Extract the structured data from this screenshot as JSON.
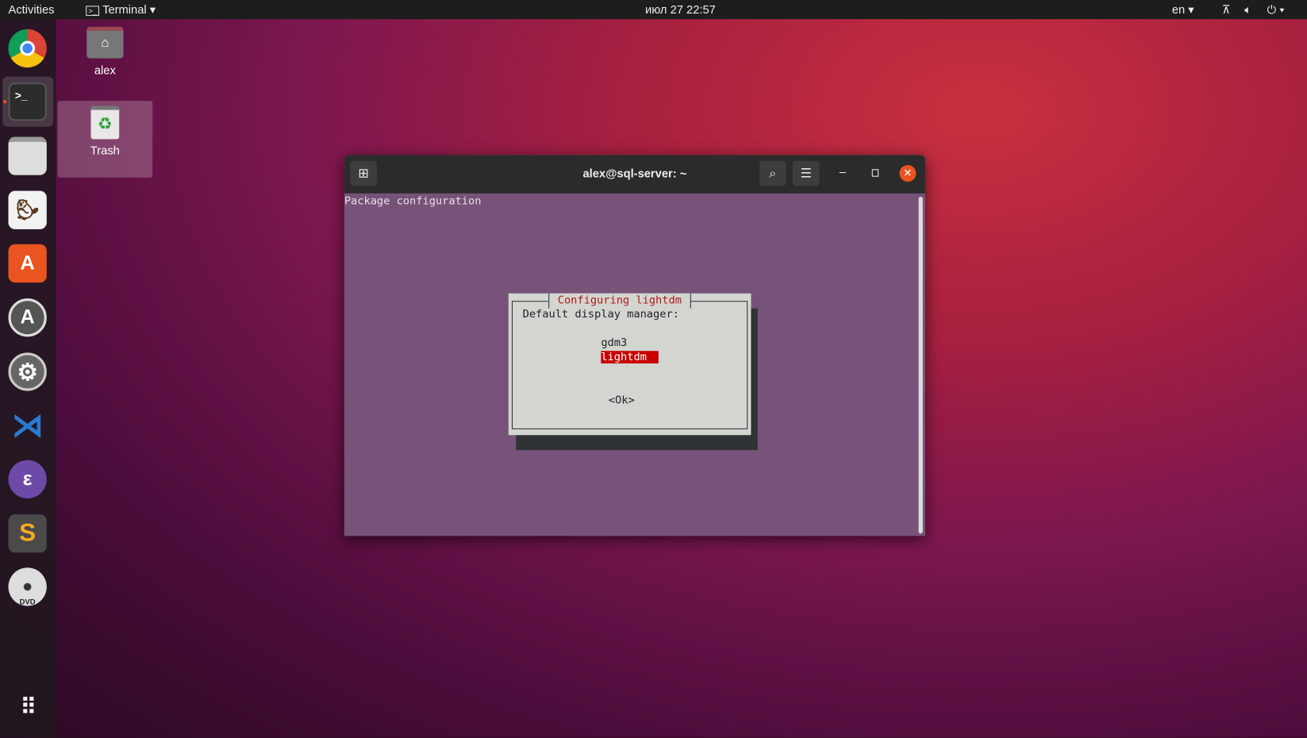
{
  "topbar": {
    "activities": "Activities",
    "app_menu": "Terminal",
    "clock": "июл 27  22:57",
    "lang": "en"
  },
  "dock": {
    "items": [
      "Google Chrome",
      "Terminal",
      "Files",
      "DBeaver CE",
      "Ubuntu Software",
      "Software Updater",
      "Settings",
      "Visual Studio Code",
      "Emacs",
      "Sublime Text",
      "DVD",
      "Show Applications"
    ],
    "vscode_color": "#2a7ad1",
    "ubuntu_orange": "#e95420"
  },
  "desktop": {
    "home_label": "alex",
    "trash_label": "Trash"
  },
  "terminal": {
    "title": "alex@sql-server: ~",
    "header": "Package configuration",
    "dialog": {
      "title": "Configuring lightdm",
      "prompt": "Default display manager:",
      "options": [
        "gdm3",
        "lightdm"
      ],
      "selected": "lightdm",
      "ok": "<Ok>"
    }
  }
}
